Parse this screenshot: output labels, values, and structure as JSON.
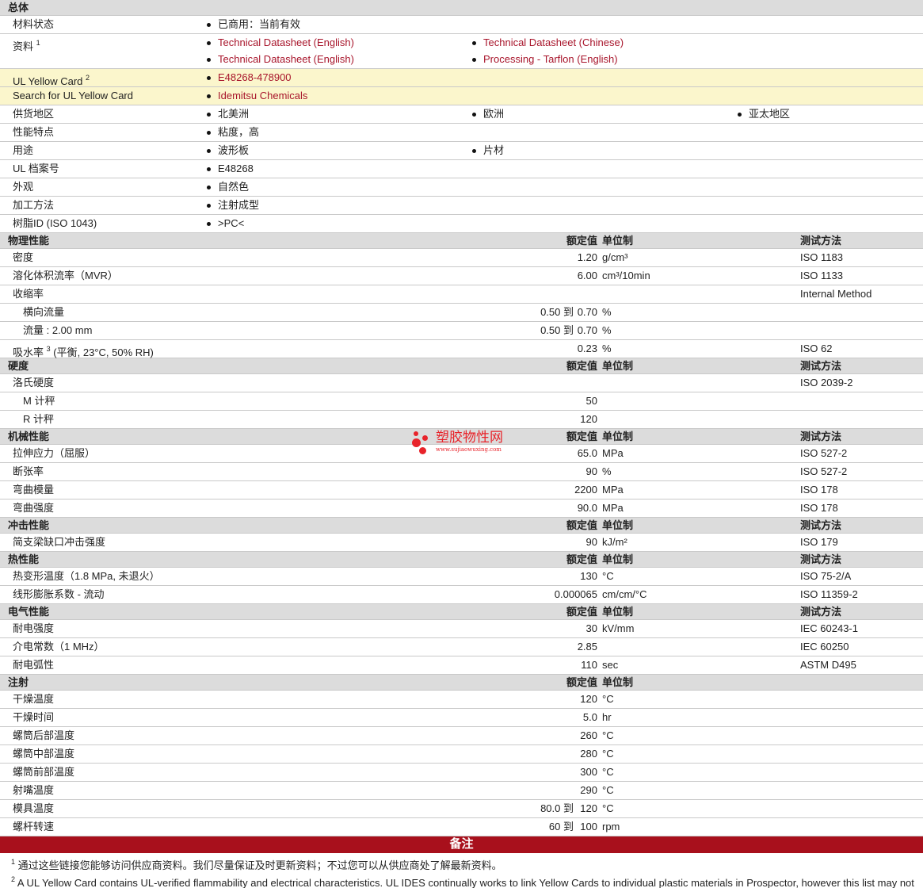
{
  "general": {
    "title": "总体",
    "material_status": {
      "label": "材料状态",
      "value": "已商用：当前有效"
    },
    "resources": {
      "label": "资料",
      "sup": "1",
      "items": [
        "Technical Datasheet (English)",
        "Technical Datasheet (Chinese)",
        "Technical Datasheet (English)",
        "Processing - Tarflon (English)"
      ]
    },
    "ul_yellow": {
      "label": "UL Yellow Card",
      "sup": "2",
      "value": "E48268-478900"
    },
    "search_ul": {
      "label": "Search for UL Yellow Card",
      "value": "Idemitsu Chemicals"
    },
    "supply": {
      "label": "供货地区",
      "items": [
        "北美洲",
        "欧洲",
        "亚太地区"
      ]
    },
    "features": {
      "label": "性能特点",
      "value": "粘度，高"
    },
    "uses": {
      "label": "用途",
      "items": [
        "波形板",
        "片材"
      ]
    },
    "ul_file": {
      "label": "UL 档案号",
      "value": "E48268"
    },
    "appearance": {
      "label": "外观",
      "value": "自然色"
    },
    "processing": {
      "label": "加工方法",
      "value": "注射成型"
    },
    "resin_id": {
      "label": "树脂ID (ISO 1043)",
      "value": ">PC<"
    }
  },
  "col_headers": {
    "value": "额定值",
    "unit": "单位制",
    "method": "测试方法"
  },
  "physical": {
    "title": "物理性能",
    "density": {
      "label": "密度",
      "value": "1.20",
      "unit": "g/cm³",
      "method": "ISO 1183"
    },
    "mvr": {
      "label": "溶化体积流率（MVR）",
      "value": "6.00",
      "unit": "cm³/10min",
      "method": "ISO 1133"
    },
    "shrink": {
      "label": "收缩率",
      "method": "Internal Method"
    },
    "shrink_cross": {
      "label": "横向流量",
      "from": "0.50 到",
      "to": "0.70",
      "unit": "%"
    },
    "shrink_flow": {
      "label": "流量 : 2.00 mm",
      "from": "0.50 到",
      "to": "0.70",
      "unit": "%"
    },
    "water": {
      "label": "吸水率",
      "sup": "3",
      "label2": "(平衡, 23°C, 50% RH)",
      "value": "0.23",
      "unit": "%",
      "method": "ISO 62"
    }
  },
  "hardness": {
    "title": "硬度",
    "rockwell": {
      "label": "洛氏硬度",
      "method": "ISO 2039-2"
    },
    "m": {
      "label": "M 计秤",
      "value": "50"
    },
    "r": {
      "label": "R 计秤",
      "value": "120"
    }
  },
  "mechanical": {
    "title": "机械性能",
    "tensile": {
      "label": "拉伸应力（屈服）",
      "value": "65.0",
      "unit": "MPa",
      "method": "ISO 527-2"
    },
    "elong": {
      "label": "断张率",
      "value": "90",
      "unit": "%",
      "method": "ISO 527-2"
    },
    "flex_mod": {
      "label": "弯曲模量",
      "value": "2200",
      "unit": "MPa",
      "method": "ISO 178"
    },
    "flex_str": {
      "label": "弯曲强度",
      "value": "90.0",
      "unit": "MPa",
      "method": "ISO 178"
    }
  },
  "impact": {
    "title": "冲击性能",
    "charpy": {
      "label": "简支梁缺口冲击强度",
      "value": "90",
      "unit": "kJ/m²",
      "method": "ISO 179"
    }
  },
  "thermal": {
    "title": "热性能",
    "hdt": {
      "label": "热变形温度（1.8 MPa, 未退火）",
      "value": "130",
      "unit": "°C",
      "method": "ISO 75-2/A"
    },
    "clte": {
      "label": "线形膨胀系数 - 流动",
      "value": "0.000065",
      "unit": "cm/cm/°C",
      "method": "ISO 11359-2"
    }
  },
  "electrical": {
    "title": "电气性能",
    "dielectric_str": {
      "label": "耐电强度",
      "value": "30",
      "unit": "kV/mm",
      "method": "IEC 60243-1"
    },
    "dielectric_const": {
      "label": "介电常数（1 MHz）",
      "value": "2.85",
      "method": "IEC 60250"
    },
    "arc": {
      "label": "耐电弧性",
      "value": "110",
      "unit": "sec",
      "method": "ASTM D495"
    }
  },
  "injection": {
    "title": "注射",
    "rows": [
      {
        "label": "干燥温度",
        "value": "120",
        "unit": "°C"
      },
      {
        "label": "干燥时间",
        "value": "5.0",
        "unit": "hr"
      },
      {
        "label": "螺筒后部温度",
        "value": "260",
        "unit": "°C"
      },
      {
        "label": "螺筒中部温度",
        "value": "280",
        "unit": "°C"
      },
      {
        "label": "螺筒前部温度",
        "value": "300",
        "unit": "°C"
      },
      {
        "label": "射嘴温度",
        "value": "290",
        "unit": "°C"
      }
    ],
    "mold": {
      "label": "模具温度",
      "from": "80.0 到",
      "to": "120",
      "unit": "°C"
    },
    "screw": {
      "label": "螺杆转速",
      "from": "60 到",
      "to": "100",
      "unit": "rpm"
    }
  },
  "notes": {
    "title": "备注",
    "n1_sup": "1",
    "n1": "通过这些链接您能够访问供应商资料。我们尽量保证及时更新资料；不过您可以从供应商处了解最新资料。",
    "n2_sup": "2",
    "n2": "A UL Yellow Card contains UL-verified flammability and electrical characteristics. UL IDES continually works to link Yellow Cards to individual plastic materials in Prospector, however this list may not"
  },
  "watermark": {
    "text": "塑胶物性网",
    "sub": "www.sujiaowuxing.com"
  },
  "colors": {
    "link": "#a8152b",
    "header_bg": "#dcdcdc",
    "yellow_bg": "#fbf6cc",
    "notes_bar": "#a8101c"
  }
}
